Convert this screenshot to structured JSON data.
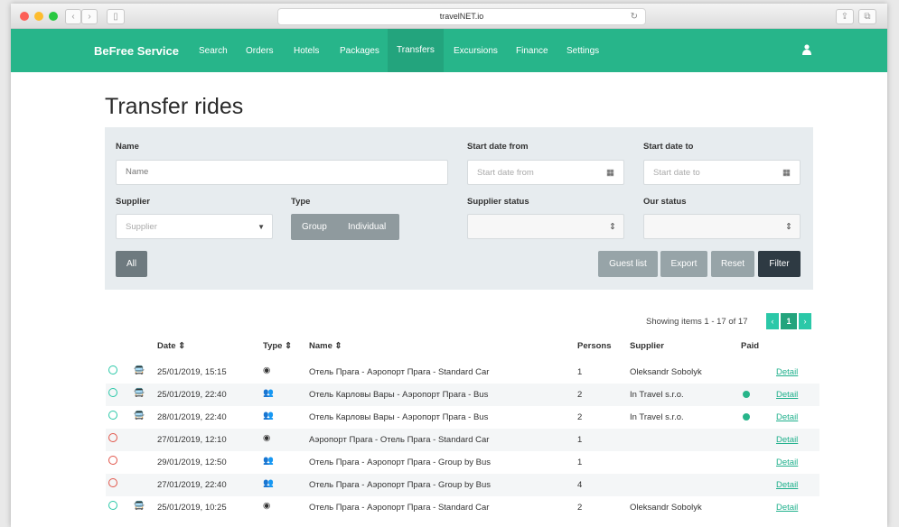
{
  "browser": {
    "url": "travelNET.io"
  },
  "nav": {
    "brand": "BeFree Service",
    "items": [
      "Search",
      "Orders",
      "Hotels",
      "Packages",
      "Transfers",
      "Excursions",
      "Finance",
      "Settings"
    ],
    "active": "Transfers"
  },
  "page": {
    "title": "Transfer rides"
  },
  "filters": {
    "name_label": "Name",
    "name_placeholder": "Name",
    "start_from_label": "Start date from",
    "start_from_placeholder": "Start date from",
    "start_to_label": "Start date to",
    "start_to_placeholder": "Start date to",
    "supplier_label": "Supplier",
    "supplier_placeholder": "Supplier",
    "type_label": "Type",
    "type_group": "Group",
    "type_individual": "Individual",
    "supplier_status_label": "Supplier status",
    "our_status_label": "Our status",
    "all_label": "All",
    "guest_list": "Guest list",
    "export": "Export",
    "reset": "Reset",
    "filter": "Filter"
  },
  "summary": {
    "showing": "Showing items 1 - 17 of 17",
    "page": "1"
  },
  "table": {
    "headers": {
      "date": "Date ⇕",
      "type": "Type ⇕",
      "name": "Name ⇕",
      "persons": "Persons",
      "supplier": "Supplier",
      "paid": "Paid"
    },
    "rows": [
      {
        "status": "green",
        "bus": true,
        "date": "25/01/2019, 15:15",
        "type": "single",
        "name": "Отель Прага - Аэропорт Прага - Standard Car",
        "persons": "1",
        "supplier": "Oleksandr Sobolyk",
        "paid": false,
        "detail": "Detail"
      },
      {
        "status": "green",
        "bus": true,
        "date": "25/01/2019, 22:40",
        "type": "group",
        "name": "Отель Карловы Вары - Аэропорт Прага - Bus",
        "persons": "2",
        "supplier": "In Travel s.r.o.",
        "paid": true,
        "detail": "Detail"
      },
      {
        "status": "green",
        "bus": true,
        "date": "28/01/2019, 22:40",
        "type": "group",
        "name": "Отель Карловы Вары - Аэропорт Прага - Bus",
        "persons": "2",
        "supplier": "In Travel s.r.o.",
        "paid": true,
        "detail": "Detail"
      },
      {
        "status": "red",
        "bus": false,
        "date": "27/01/2019, 12:10",
        "type": "single",
        "name": "Аэропорт Прага - Отель Прага - Standard Car",
        "persons": "1",
        "supplier": "",
        "paid": false,
        "detail": "Detail"
      },
      {
        "status": "red",
        "bus": false,
        "date": "29/01/2019, 12:50",
        "type": "group",
        "name": "Отель Прага - Аэропорт Прага - Group by Bus",
        "persons": "1",
        "supplier": "",
        "paid": false,
        "detail": "Detail"
      },
      {
        "status": "red",
        "bus": false,
        "date": "27/01/2019, 22:40",
        "type": "group",
        "name": "Отель Прага - Аэропорт Прага - Group by Bus",
        "persons": "4",
        "supplier": "",
        "paid": false,
        "detail": "Detail"
      },
      {
        "status": "green",
        "bus": true,
        "date": "25/01/2019, 10:25",
        "type": "single",
        "name": "Отель Прага - Аэропорт Прага - Standard Car",
        "persons": "2",
        "supplier": "Oleksandr Sobolyk",
        "paid": false,
        "detail": "Detail"
      }
    ]
  }
}
